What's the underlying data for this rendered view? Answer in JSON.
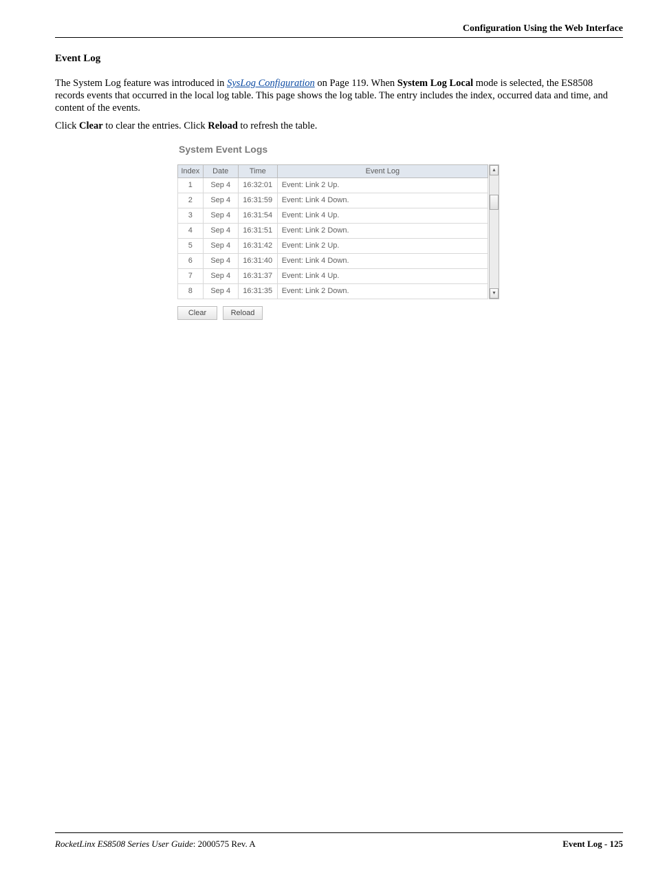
{
  "header": {
    "title": "Configuration Using the Web Interface"
  },
  "section": {
    "heading": "Event Log"
  },
  "para1": {
    "pre": "The System Log feature was introduced in ",
    "link": "SysLog Configuration",
    "post_link": " on Page 119. When ",
    "bold1": "System Log Local",
    "after_bold1": " mode is selected, the ES8508 records events that occurred in the local log table. This page shows the log table. The entry includes the index, occurred data and time, and content of the events."
  },
  "para2": {
    "pre": "Click ",
    "b1": "Clear",
    "mid": " to clear the entries. Click ",
    "b2": "Reload",
    "post": " to refresh the table."
  },
  "screenshot": {
    "title": "System Event Logs",
    "columns": {
      "index": "Index",
      "date": "Date",
      "time": "Time",
      "event": "Event Log"
    },
    "rows": [
      {
        "index": "1",
        "date": "Sep 4",
        "time": "16:32:01",
        "event": "Event: Link 2 Up."
      },
      {
        "index": "2",
        "date": "Sep 4",
        "time": "16:31:59",
        "event": "Event: Link 4 Down."
      },
      {
        "index": "3",
        "date": "Sep 4",
        "time": "16:31:54",
        "event": "Event: Link 4 Up."
      },
      {
        "index": "4",
        "date": "Sep 4",
        "time": "16:31:51",
        "event": "Event: Link 2 Down."
      },
      {
        "index": "5",
        "date": "Sep 4",
        "time": "16:31:42",
        "event": "Event: Link 2 Up."
      },
      {
        "index": "6",
        "date": "Sep 4",
        "time": "16:31:40",
        "event": "Event: Link 4 Down."
      },
      {
        "index": "7",
        "date": "Sep 4",
        "time": "16:31:37",
        "event": "Event: Link 4 Up."
      },
      {
        "index": "8",
        "date": "Sep 4",
        "time": "16:31:35",
        "event": "Event: Link 2 Down."
      }
    ],
    "buttons": {
      "clear": "Clear",
      "reload": "Reload"
    },
    "scroll": {
      "up": "▴",
      "down": "▾"
    }
  },
  "footer": {
    "left_italic": "RocketLinx ES8508 Series  User Guide",
    "left_rev": ": 2000575 Rev. A",
    "right": "Event Log - 125"
  }
}
